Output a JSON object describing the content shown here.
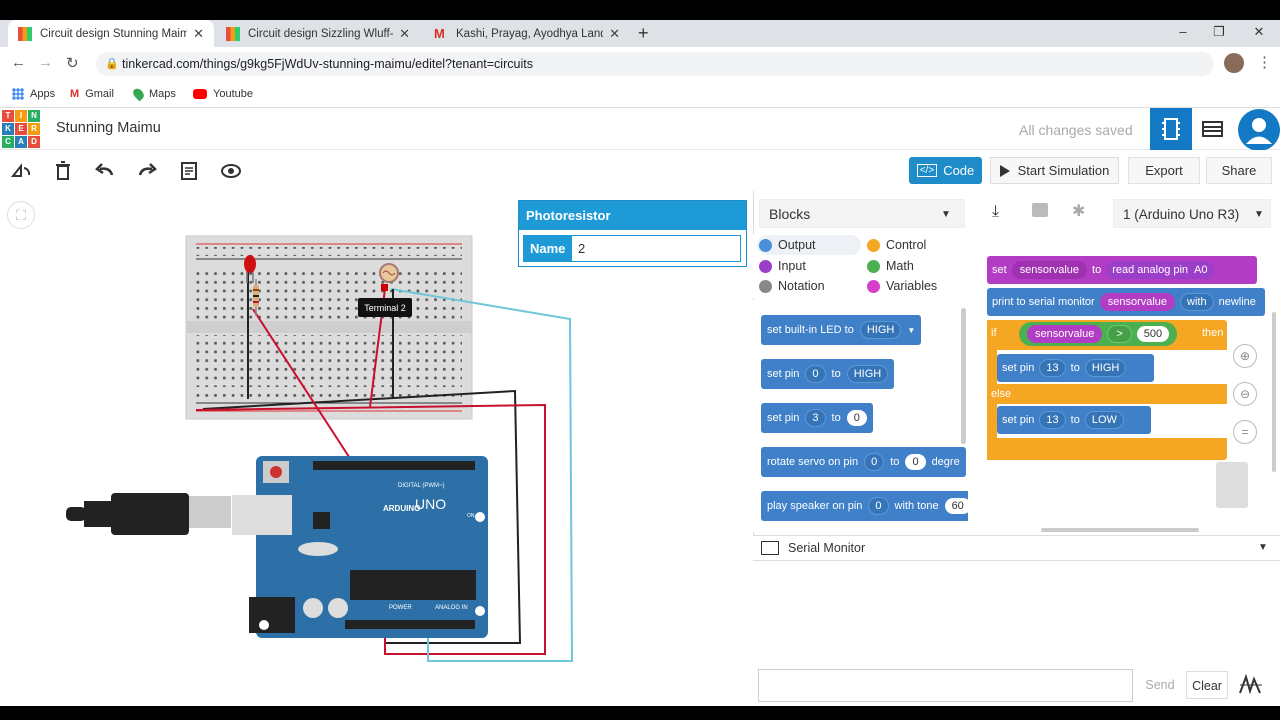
{
  "browser": {
    "tabs": [
      {
        "title": "Circuit design Stunning Maimu |",
        "active": true
      },
      {
        "title": "Circuit design Sizzling Wluff-Hilla",
        "active": false
      },
      {
        "title": "Kashi, Prayag, Ayodhya Land Tou",
        "active": false
      }
    ],
    "new_tab": "+",
    "url": "tinkercad.com/things/g9kg5FjWdUv-stunning-maimu/editel?tenant=circuits",
    "bookmarks": [
      "Apps",
      "Gmail",
      "Maps",
      "Youtube"
    ],
    "window_controls": [
      "–",
      "❐",
      "✕"
    ]
  },
  "app": {
    "logo_letters": [
      "T",
      "I",
      "N",
      "K",
      "E",
      "R",
      "C",
      "A",
      "D"
    ],
    "project_name": "Stunning Maimu",
    "save_status": "All changes saved"
  },
  "toolbar": {
    "code_label": "Code",
    "start_simulation_label": "Start Simulation",
    "export_label": "Export",
    "share_label": "Share"
  },
  "canvas": {
    "tooltip": "Terminal 2",
    "arduino_labels": {
      "digital": "DIGITAL (PWM~)",
      "brand": "ARDUINO",
      "model": "UNO",
      "power": "POWER",
      "analog": "ANALOG IN",
      "on": "ON"
    }
  },
  "inspector": {
    "title": "Photoresistor",
    "name_label": "Name",
    "name_value": "2"
  },
  "code_panel": {
    "mode": "Blocks",
    "board": "1 (Arduino Uno R3)",
    "categories": [
      {
        "label": "Output",
        "color": "#4a90d9"
      },
      {
        "label": "Control",
        "color": "#f5a623"
      },
      {
        "label": "Input",
        "color": "#9b3fc9"
      },
      {
        "label": "Math",
        "color": "#4caf50"
      },
      {
        "label": "Notation",
        "color": "#888888"
      },
      {
        "label": "Variables",
        "color": "#d53fc9"
      }
    ],
    "palette": {
      "b1": {
        "a": "set built-in LED to",
        "b": "HIGH"
      },
      "b2": {
        "a": "set pin",
        "b": "0",
        "c": "to",
        "d": "HIGH"
      },
      "b3": {
        "a": "set pin",
        "b": "3",
        "c": "to",
        "d": "0"
      },
      "b4": {
        "a": "rotate servo on pin",
        "b": "0",
        "c": "to",
        "d": "0",
        "e": "degre"
      },
      "b5": {
        "a": "play speaker on pin",
        "b": "0",
        "c": "with tone",
        "d": "60"
      }
    },
    "script": {
      "set": "set",
      "var": "sensorvalue",
      "to": "to",
      "read": "read analog pin",
      "pin": "A0",
      "print": "print to serial monitor",
      "print_var": "sensorvalue",
      "with": "with",
      "newline": "newline",
      "if": "if",
      "cmp_var": "sensorvalue",
      "op": ">",
      "threshold": "500",
      "then": "then",
      "setpin": "set pin",
      "pin_hi": "13",
      "to2": "to",
      "high": "HIGH",
      "else": "else",
      "setpin2": "set pin",
      "pin_lo": "13",
      "to3": "to",
      "low": "LOW"
    },
    "serial_monitor": {
      "title": "Serial Monitor",
      "send_label": "Send",
      "clear_label": "Clear"
    }
  }
}
